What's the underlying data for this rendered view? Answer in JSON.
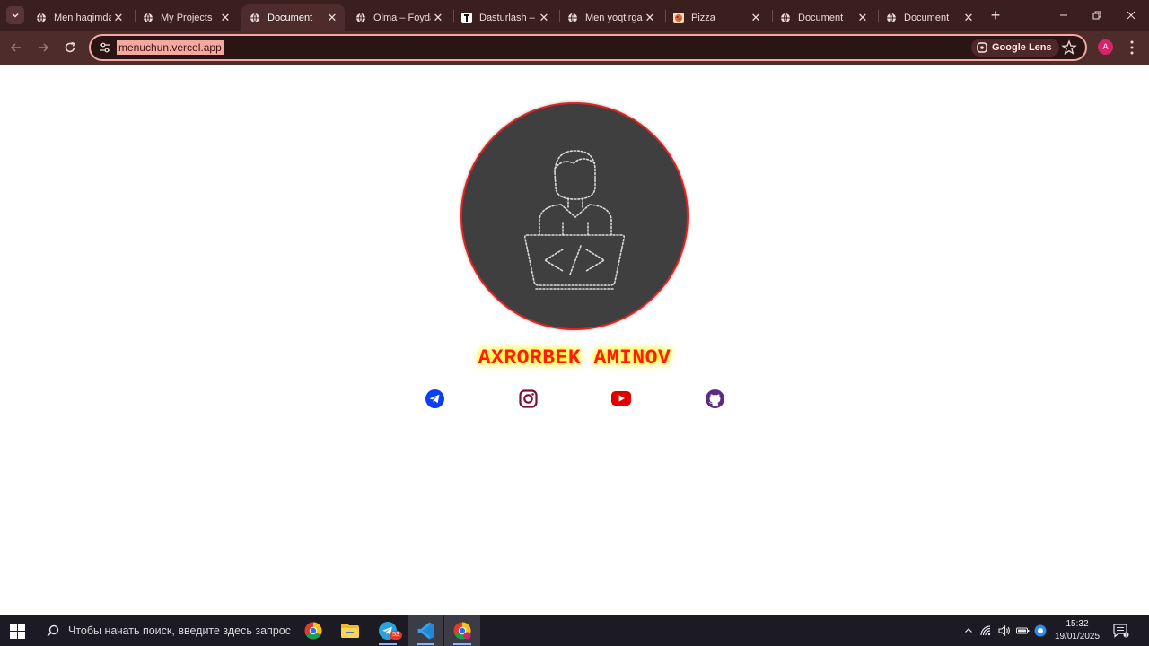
{
  "browser": {
    "tabs": [
      {
        "title": "Men haqimda",
        "active": false
      },
      {
        "title": "My Projects",
        "active": false
      },
      {
        "title": "Document",
        "active": true
      },
      {
        "title": "Olma – Foydalanuvchi",
        "active": false
      },
      {
        "title": "Dasturlash – Telegraph",
        "active": false
      },
      {
        "title": "Men yoqtirgan",
        "active": false
      },
      {
        "title": "Pizza",
        "active": false
      },
      {
        "title": "Document",
        "active": false
      },
      {
        "title": "Document",
        "active": false
      }
    ],
    "url": "menuchun.vercel.app",
    "lens_label": "Google Lens",
    "profile_initial": "A",
    "colors": {
      "frame": "#3b1f1f",
      "toolbar": "#4f2c2c",
      "url_highlight": "#f4a9a0"
    }
  },
  "page": {
    "name": "AXRORBEK AMINOV",
    "colors": {
      "name": "#ff1a1a",
      "name_glow": "#fff200",
      "avatar_bg": "#3f3f3f",
      "avatar_border": "#e52222"
    },
    "socials": [
      {
        "icon": "telegram-icon",
        "color": "#0a3ef0"
      },
      {
        "icon": "instagram-icon",
        "color": "#7a1030"
      },
      {
        "icon": "youtube-icon",
        "color": "#e00000"
      },
      {
        "icon": "github-icon",
        "color": "#5a2d82"
      }
    ]
  },
  "taskbar": {
    "search_placeholder": "Чтобы начать поиск, введите здесь запрос",
    "telegram_badge": "53",
    "time": "15:32",
    "date": "19/01/2025"
  }
}
